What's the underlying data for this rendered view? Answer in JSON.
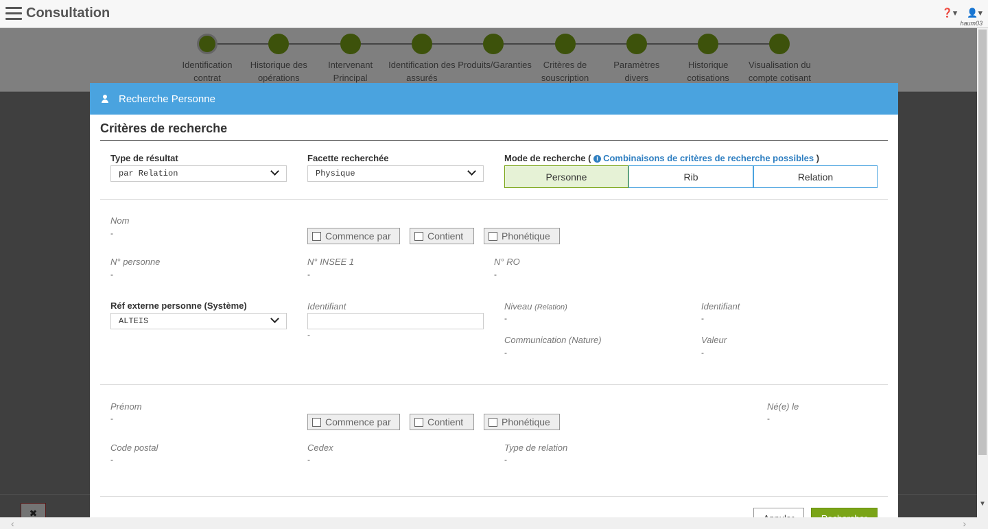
{
  "app": {
    "title": "Consultation",
    "username": "haum03",
    "help_icon": "help-circle-icon",
    "user_icon": "user-icon"
  },
  "stepper": [
    {
      "label": "Identification contrat",
      "active": true
    },
    {
      "label": "Historique des opérations"
    },
    {
      "label": "Intervenant Principal"
    },
    {
      "label": "Identification des assurés"
    },
    {
      "label": "Produits/Garanties"
    },
    {
      "label": "Critères de souscription"
    },
    {
      "label": "Paramètres divers"
    },
    {
      "label": "Historique cotisations"
    },
    {
      "label": "Visualisation du compte cotisant"
    }
  ],
  "modal": {
    "title": "Recherche Personne",
    "section_title": "Critères de recherche",
    "type_resultat": {
      "label": "Type de résultat",
      "value": "par Relation"
    },
    "facette": {
      "label": "Facette recherchée",
      "value": "Physique"
    },
    "mode": {
      "label": "Mode de recherche (",
      "link": "Combinaisons de critères de recherche possibles",
      "close": ")",
      "buttons": [
        "Personne",
        "Rib",
        "Relation"
      ],
      "active": "Personne"
    },
    "nom": {
      "label": "Nom",
      "value": "-"
    },
    "match_options": [
      "Commence par",
      "Contient",
      "Phonétique"
    ],
    "num_personne": {
      "label": "N° personne",
      "value": "-"
    },
    "insee": {
      "label": "N° INSEE 1",
      "value": "-"
    },
    "num_ro": {
      "label": "N° RO",
      "value": "-"
    },
    "ref_externe": {
      "label": "Réf externe personne (Système)",
      "value": "ALTEIS"
    },
    "identifiant": {
      "label": "Identifiant",
      "value": "-"
    },
    "niveau": {
      "label": "Niveau",
      "sub": "(Relation)",
      "value": "-"
    },
    "identifiant2": {
      "label": "Identifiant",
      "value": "-"
    },
    "communication": {
      "label": "Communication (Nature)",
      "value": "-"
    },
    "valeur": {
      "label": "Valeur",
      "value": "-"
    },
    "prenom": {
      "label": "Prénom",
      "value": "-"
    },
    "ne_le": {
      "label": "Né(e) le",
      "value": "-"
    },
    "code_postal": {
      "label": "Code postal",
      "value": "-"
    },
    "cedex": {
      "label": "Cedex",
      "value": "-"
    },
    "type_relation": {
      "label": "Type de relation",
      "value": "-"
    },
    "cancel_label": "Annuler",
    "search_label": "Rechercher"
  },
  "colors": {
    "header_blue": "#4aa3df",
    "step_green": "#7aa417",
    "link_blue": "#2f7fc1"
  }
}
